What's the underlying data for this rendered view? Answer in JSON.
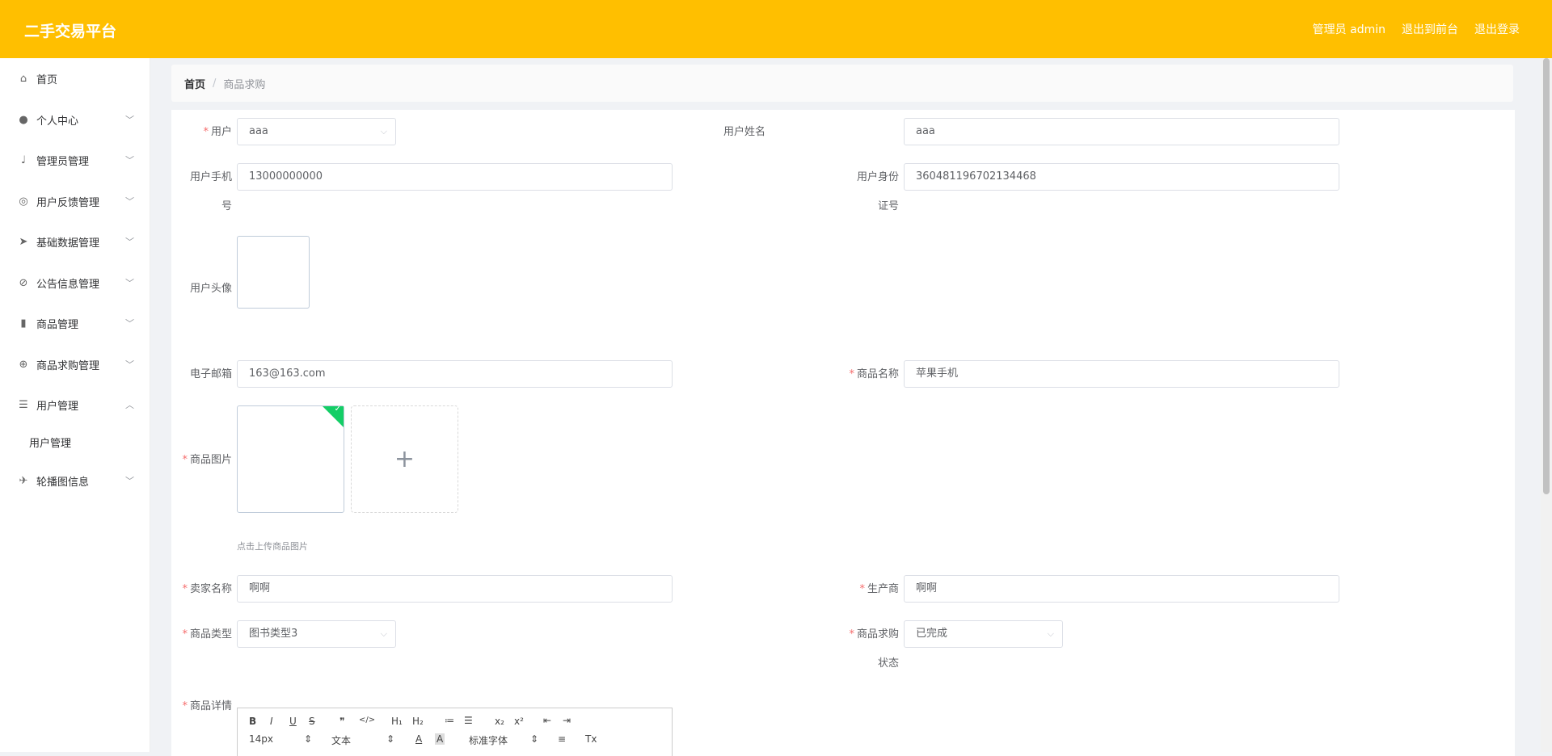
{
  "app": {
    "title": "二手交易平台"
  },
  "header": {
    "admin_label": "管理员 admin",
    "frontend_link": "退出到前台",
    "logout_link": "退出登录"
  },
  "sidebar": {
    "items": [
      {
        "label": "首页",
        "icon": "home-icon"
      },
      {
        "label": "个人中心",
        "icon": "user-icon"
      },
      {
        "label": "管理员管理",
        "icon": "microphone-icon"
      },
      {
        "label": "用户反馈管理",
        "icon": "compass-icon"
      },
      {
        "label": "基础数据管理",
        "icon": "send-icon"
      },
      {
        "label": "公告信息管理",
        "icon": "bell-off-icon"
      },
      {
        "label": "商品管理",
        "icon": "bar-chart-icon"
      },
      {
        "label": "商品求购管理",
        "icon": "crosshair-icon"
      },
      {
        "label": "用户管理",
        "icon": "list-icon"
      },
      {
        "label": "轮播图信息",
        "icon": "paper-plane-icon"
      }
    ],
    "sub_item": "用户管理"
  },
  "breadcrumb": {
    "home": "首页",
    "separator": "/",
    "current": "商品求购"
  },
  "form": {
    "user": {
      "label": "用户",
      "value": "aaa"
    },
    "user_name": {
      "label": "用户姓名",
      "value": "aaa"
    },
    "user_phone": {
      "label_line1": "用户手机",
      "label_line2": "号",
      "value": "13000000000"
    },
    "user_id_card": {
      "label_line1": "用户身份",
      "label_line2": "证号",
      "value": "360481196702134468"
    },
    "user_avatar": {
      "label": "用户头像"
    },
    "email": {
      "label": "电子邮箱",
      "value": "163@163.com"
    },
    "product_name": {
      "label": "商品名称",
      "value": "苹果手机"
    },
    "product_image": {
      "label": "商品图片",
      "hint": "点击上传商品图片",
      "plus": "+",
      "check": "✓"
    },
    "seller_name": {
      "label": "卖家名称",
      "value": "啊啊"
    },
    "manufacturer": {
      "label": "生产商",
      "value": "啊啊"
    },
    "product_type": {
      "label": "商品类型",
      "value": "图书类型3"
    },
    "purchase_status": {
      "label_line1": "商品求购",
      "label_line2": "状态",
      "value": "已完成"
    },
    "product_detail": {
      "label": "商品详情"
    },
    "required_mark": "*",
    "select_arrow": "⌵"
  },
  "editor": {
    "row1": [
      "B",
      "I",
      "U",
      "S",
      "❞",
      "</>",
      "H₁",
      "H₂",
      "≔",
      "☰",
      "x₂",
      "x²",
      "⇤",
      "⇥"
    ],
    "font_size": "14px",
    "header_type": "文本",
    "font_family": "标准字体",
    "color_btn": "A",
    "bg_btn": "A",
    "align_btn": "≡",
    "clear_btn": "Tx",
    "spinner": "⇕"
  },
  "colors": {
    "header_bg": "#ffbf00",
    "required": "#f56c6c",
    "upload_success": "#13ce66"
  }
}
